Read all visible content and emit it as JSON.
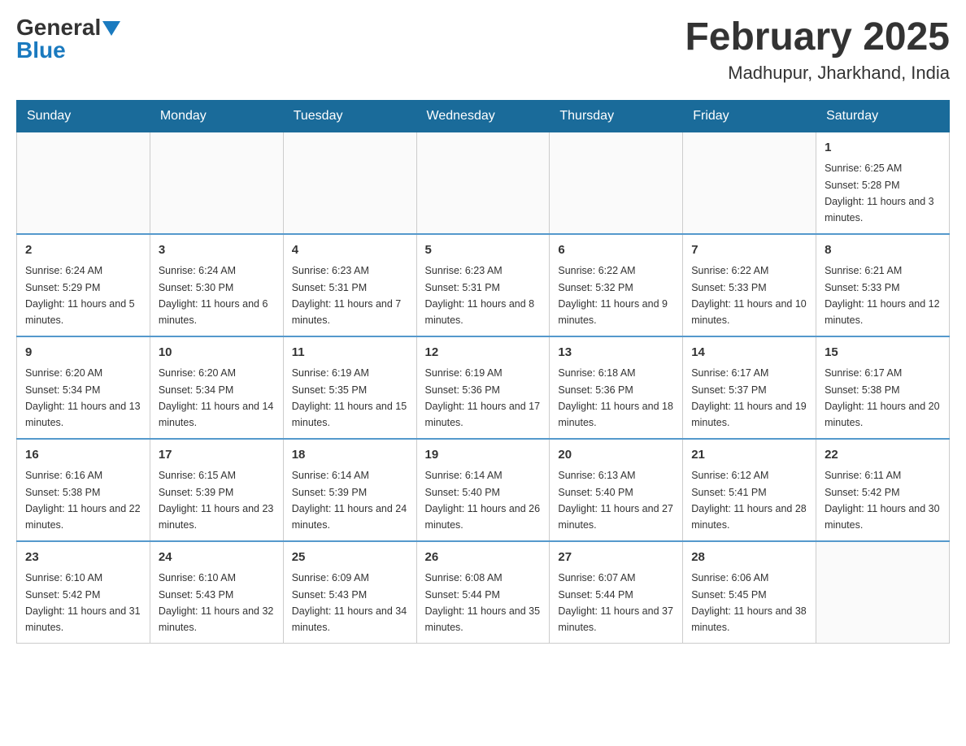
{
  "header": {
    "logo_general": "General",
    "logo_blue": "Blue",
    "title": "February 2025",
    "subtitle": "Madhupur, Jharkhand, India"
  },
  "weekdays": [
    "Sunday",
    "Monday",
    "Tuesday",
    "Wednesday",
    "Thursday",
    "Friday",
    "Saturday"
  ],
  "weeks": [
    [
      {
        "day": "",
        "info": ""
      },
      {
        "day": "",
        "info": ""
      },
      {
        "day": "",
        "info": ""
      },
      {
        "day": "",
        "info": ""
      },
      {
        "day": "",
        "info": ""
      },
      {
        "day": "",
        "info": ""
      },
      {
        "day": "1",
        "info": "Sunrise: 6:25 AM\nSunset: 5:28 PM\nDaylight: 11 hours and 3 minutes."
      }
    ],
    [
      {
        "day": "2",
        "info": "Sunrise: 6:24 AM\nSunset: 5:29 PM\nDaylight: 11 hours and 5 minutes."
      },
      {
        "day": "3",
        "info": "Sunrise: 6:24 AM\nSunset: 5:30 PM\nDaylight: 11 hours and 6 minutes."
      },
      {
        "day": "4",
        "info": "Sunrise: 6:23 AM\nSunset: 5:31 PM\nDaylight: 11 hours and 7 minutes."
      },
      {
        "day": "5",
        "info": "Sunrise: 6:23 AM\nSunset: 5:31 PM\nDaylight: 11 hours and 8 minutes."
      },
      {
        "day": "6",
        "info": "Sunrise: 6:22 AM\nSunset: 5:32 PM\nDaylight: 11 hours and 9 minutes."
      },
      {
        "day": "7",
        "info": "Sunrise: 6:22 AM\nSunset: 5:33 PM\nDaylight: 11 hours and 10 minutes."
      },
      {
        "day": "8",
        "info": "Sunrise: 6:21 AM\nSunset: 5:33 PM\nDaylight: 11 hours and 12 minutes."
      }
    ],
    [
      {
        "day": "9",
        "info": "Sunrise: 6:20 AM\nSunset: 5:34 PM\nDaylight: 11 hours and 13 minutes."
      },
      {
        "day": "10",
        "info": "Sunrise: 6:20 AM\nSunset: 5:34 PM\nDaylight: 11 hours and 14 minutes."
      },
      {
        "day": "11",
        "info": "Sunrise: 6:19 AM\nSunset: 5:35 PM\nDaylight: 11 hours and 15 minutes."
      },
      {
        "day": "12",
        "info": "Sunrise: 6:19 AM\nSunset: 5:36 PM\nDaylight: 11 hours and 17 minutes."
      },
      {
        "day": "13",
        "info": "Sunrise: 6:18 AM\nSunset: 5:36 PM\nDaylight: 11 hours and 18 minutes."
      },
      {
        "day": "14",
        "info": "Sunrise: 6:17 AM\nSunset: 5:37 PM\nDaylight: 11 hours and 19 minutes."
      },
      {
        "day": "15",
        "info": "Sunrise: 6:17 AM\nSunset: 5:38 PM\nDaylight: 11 hours and 20 minutes."
      }
    ],
    [
      {
        "day": "16",
        "info": "Sunrise: 6:16 AM\nSunset: 5:38 PM\nDaylight: 11 hours and 22 minutes."
      },
      {
        "day": "17",
        "info": "Sunrise: 6:15 AM\nSunset: 5:39 PM\nDaylight: 11 hours and 23 minutes."
      },
      {
        "day": "18",
        "info": "Sunrise: 6:14 AM\nSunset: 5:39 PM\nDaylight: 11 hours and 24 minutes."
      },
      {
        "day": "19",
        "info": "Sunrise: 6:14 AM\nSunset: 5:40 PM\nDaylight: 11 hours and 26 minutes."
      },
      {
        "day": "20",
        "info": "Sunrise: 6:13 AM\nSunset: 5:40 PM\nDaylight: 11 hours and 27 minutes."
      },
      {
        "day": "21",
        "info": "Sunrise: 6:12 AM\nSunset: 5:41 PM\nDaylight: 11 hours and 28 minutes."
      },
      {
        "day": "22",
        "info": "Sunrise: 6:11 AM\nSunset: 5:42 PM\nDaylight: 11 hours and 30 minutes."
      }
    ],
    [
      {
        "day": "23",
        "info": "Sunrise: 6:10 AM\nSunset: 5:42 PM\nDaylight: 11 hours and 31 minutes."
      },
      {
        "day": "24",
        "info": "Sunrise: 6:10 AM\nSunset: 5:43 PM\nDaylight: 11 hours and 32 minutes."
      },
      {
        "day": "25",
        "info": "Sunrise: 6:09 AM\nSunset: 5:43 PM\nDaylight: 11 hours and 34 minutes."
      },
      {
        "day": "26",
        "info": "Sunrise: 6:08 AM\nSunset: 5:44 PM\nDaylight: 11 hours and 35 minutes."
      },
      {
        "day": "27",
        "info": "Sunrise: 6:07 AM\nSunset: 5:44 PM\nDaylight: 11 hours and 37 minutes."
      },
      {
        "day": "28",
        "info": "Sunrise: 6:06 AM\nSunset: 5:45 PM\nDaylight: 11 hours and 38 minutes."
      },
      {
        "day": "",
        "info": ""
      }
    ]
  ]
}
